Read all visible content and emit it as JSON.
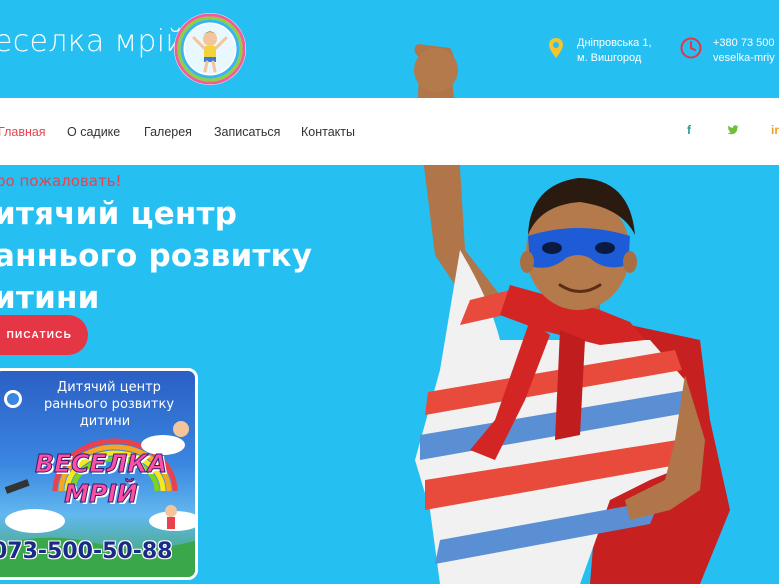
{
  "header": {
    "brand": "еселка мрій",
    "address_line1": "Дніпровська 1,",
    "address_line2": "м. Вишгород",
    "phone": "+380 73 500",
    "email": "veselka-mriy"
  },
  "nav": {
    "items": [
      {
        "label": "Главная",
        "active": true
      },
      {
        "label": "О садике",
        "active": false
      },
      {
        "label": "Галерея",
        "active": false
      },
      {
        "label": "Записаться",
        "active": false
      },
      {
        "label": "Контакты",
        "active": false
      }
    ],
    "social": [
      {
        "icon": "facebook-icon",
        "glyph": "f",
        "color": "#2a9d8f"
      },
      {
        "icon": "twitter-icon",
        "glyph": "🐦",
        "color": "#6fbf3a"
      },
      {
        "icon": "linkedin-icon",
        "glyph": "in",
        "color": "#f0a020"
      }
    ]
  },
  "hero": {
    "welcome": "ро пожаловать!",
    "title_lines": [
      "итячий центр",
      "аннього розвитку",
      "итини"
    ],
    "cta": "ПИСАТИСЬ"
  },
  "banner": {
    "line1": "Дитячий центр",
    "line2": "раннього розвитку",
    "line3": "дитини",
    "name1": "ВЕСЕЛКА",
    "name2": "МРІЙ",
    "phone": "073-500-50-88"
  },
  "colors": {
    "background": "#25bff2",
    "accent": "#e53645",
    "nav_bg": "#ffffff"
  }
}
